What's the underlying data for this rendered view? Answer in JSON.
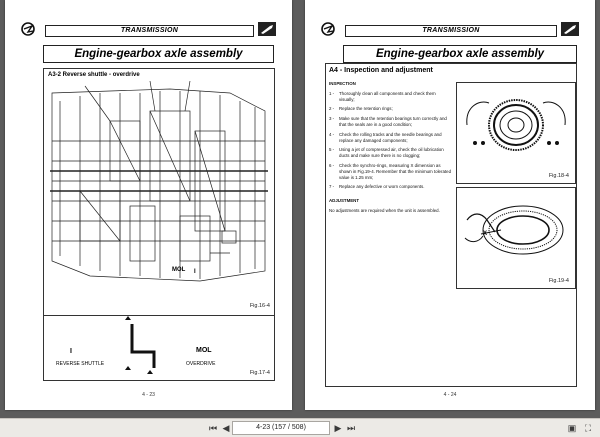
{
  "header": {
    "section": "TRANSMISSION"
  },
  "page_left": {
    "title": "Engine-gearbox axle assembly",
    "section_label": "A3-2 Reverse shuttle - overdrive",
    "mol_label": "MOL",
    "mol_roman": "I",
    "fig_a": "Fig.16-4",
    "fig_b": "Fig.17-4",
    "shuttle_left_roman": "I",
    "shuttle_right": "MOL",
    "reverse_shuttle": "REVERSE SHUTTLE",
    "overdrive": "OVERDRIVE",
    "page_number": "4 - 23"
  },
  "page_right": {
    "title": "Engine-gearbox axle assembly",
    "section_title": "A4 - Inspection and adjustment",
    "inspection_heading": "INSPECTION",
    "items": [
      {
        "num": "1 -",
        "text": "Thoroughly clean all components and check them visually;"
      },
      {
        "num": "2 -",
        "text": "Replace the retention rings;"
      },
      {
        "num": "3 -",
        "text": "Make sure that the retention bearings turn correctly and that the seals are in a good condition;"
      },
      {
        "num": "4 -",
        "text": "Check the rolling tracks and the needle bearings and replace any damaged components;"
      },
      {
        "num": "5 -",
        "text": "Using a jet of compressed air, check the oil lubrication ducts and make sure there is no clogging;"
      },
      {
        "num": "6 -",
        "text": "Check the synchro-rings, measuring X dimension as shown in Fig.19-4. Remember that the minimum tolerated value is 1.25 mm;"
      },
      {
        "num": "7 -",
        "text": "Replace any defective or worn components."
      }
    ],
    "adjustment_heading": "ADJUSTMENT",
    "adjustment_text": "No adjustments are required when the unit is assembled.",
    "fig_1": "Fig.18-4",
    "fig_2": "Fig.19-4",
    "x_label": "X",
    "page_number": "4 - 24"
  },
  "toolbar": {
    "page_indicator": "4-23 (157 / 508)"
  }
}
